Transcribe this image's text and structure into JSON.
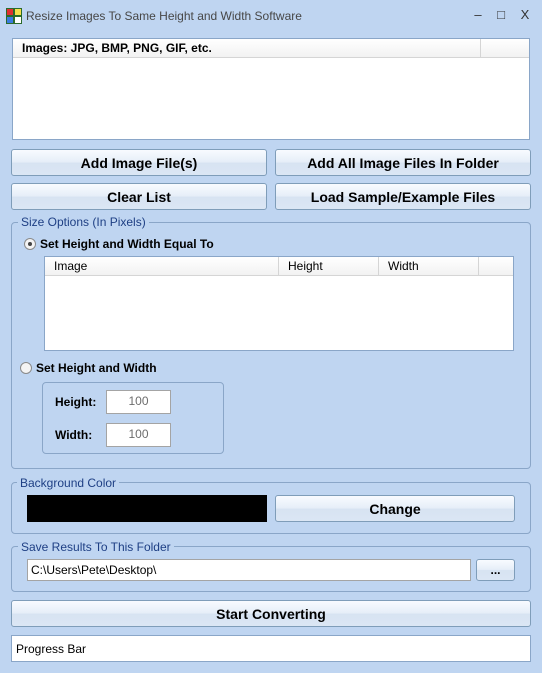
{
  "window": {
    "title": "Resize Images To Same Height and Width Software",
    "controls": {
      "minimize": "–",
      "maximize": "□",
      "close": "X"
    }
  },
  "images_list": {
    "column_header": "Images: JPG, BMP, PNG, GIF, etc."
  },
  "buttons": {
    "add_files": "Add Image File(s)",
    "add_folder": "Add All Image Files In Folder",
    "clear_list": "Clear List",
    "load_sample": "Load Sample/Example Files"
  },
  "size_options": {
    "legend": "Size Options (In Pixels)",
    "equal_option": {
      "label": "Set Height and Width Equal To",
      "selected": true
    },
    "table_columns": [
      "Image",
      "Height",
      "Width"
    ],
    "custom_option": {
      "label": "Set Height and Width",
      "selected": false
    },
    "height_label": "Height:",
    "height_value": "100",
    "width_label": "Width:",
    "width_value": "100"
  },
  "background": {
    "legend": "Background Color",
    "color": "#000000",
    "change_button": "Change"
  },
  "save": {
    "legend": "Save Results To This Folder",
    "folder": "C:\\Users\\Pete\\Desktop\\",
    "browse_button": "..."
  },
  "start_button": "Start Converting",
  "progress": {
    "label": "Progress Bar"
  },
  "colors": {
    "window_bg": "#bfd5f1",
    "legend_text": "#1e3f84",
    "border": "#8aa6c8"
  }
}
